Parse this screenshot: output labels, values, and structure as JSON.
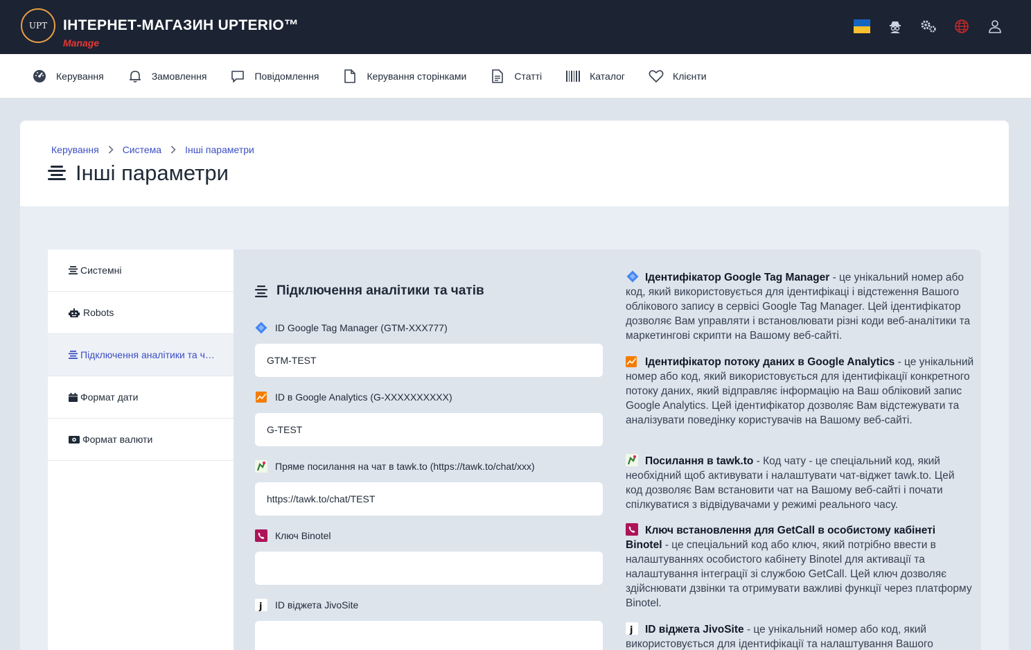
{
  "brand": {
    "logo_text": "UPT",
    "title": "ІНТЕРНЕТ-МАГАЗИН UPTERIO™",
    "subtitle": "Manage"
  },
  "top_icons": [
    "ukraine-flag-icon",
    "spy-icon",
    "gears-icon",
    "globe-icon",
    "user-icon"
  ],
  "nav": {
    "items": [
      {
        "label": "Керування",
        "icon": "dashboard-icon"
      },
      {
        "label": "Замовлення",
        "icon": "bell-icon"
      },
      {
        "label": "Повідомлення",
        "icon": "message-icon"
      },
      {
        "label": "Керування сторінками",
        "icon": "file-icon"
      },
      {
        "label": "Статті",
        "icon": "document-icon"
      },
      {
        "label": "Каталог",
        "icon": "barcode-icon"
      },
      {
        "label": "Клієнти",
        "icon": "heart-icon"
      }
    ]
  },
  "breadcrumb": [
    "Керування",
    "Система",
    "Інші параметри"
  ],
  "page_title": "Інші параметри",
  "sidebar": {
    "items": [
      {
        "label": "Системні",
        "icon": "list-icon",
        "active": false
      },
      {
        "label": "Robots",
        "icon": "robot-icon",
        "active": false
      },
      {
        "label": "Підключення аналітики та чатів",
        "icon": "list-icon",
        "active": true
      },
      {
        "label": "Формат дати",
        "icon": "calendar-icon",
        "active": false
      },
      {
        "label": "Формат валюти",
        "icon": "money-icon",
        "active": false
      }
    ]
  },
  "section_title": "Підключення аналітики та чатів",
  "fields": [
    {
      "label": "ID Google Tag Manager (GTM-XXX777)",
      "value": "GTM-TEST",
      "icon": "google-tag-manager-icon"
    },
    {
      "label": "ID в Google Analytics (G-XXXXXXXXXX)",
      "value": "G-TEST",
      "icon": "google-analytics-icon"
    },
    {
      "label": "Пряме посилання на чат в tawk.to (https://tawk.to/chat/xxx)",
      "value": "https://tawk.to/chat/TEST",
      "icon": "tawk-to-icon"
    },
    {
      "label": "Ключ Binotel",
      "value": "",
      "icon": "binotel-icon"
    },
    {
      "label": "ID віджета JivoSite",
      "value": "",
      "icon": "jivosite-icon"
    }
  ],
  "help": [
    {
      "title": "Ідентифікатор Google Tag Manager",
      "text": " - це унікальний номер або код, який використовується для ідентифікаці і відстеження Вашого облікового запису в сервісі Google Tag Manager. Цей ідентифікатор дозволяє Вам управляти і встановлювати різні коди веб-аналітики та маркетингові скрипти на Вашому веб-сайті."
    },
    {
      "title": "Ідентифікатор потоку даних в Google Analytics",
      "text": " - це унікальний номер або код, який використовується для ідентифікації конкретного потоку даних, який відправляє інформацію на Ваш обліковий запис Google Analytics. Цей ідентифікатор дозволяє Вам відстежувати та аналізувати поведінку користувачів на Вашому веб-сайті."
    },
    {
      "title": "Посилання в tawk.to",
      "text": " - Код чату - це спеціальний код, який необхідний щоб активувати і налаштувати чат-віджет tawk.to. Цей код дозволяє Вам встановити чат на Вашому веб-сайті і почати спілкуватися з відвідувачами у режимі реального часу."
    },
    {
      "title": "Ключ встановлення для GetCall в особистому кабінеті Binotel",
      "text": " - це спеціальний код або ключ, який потрібно ввести в налаштуваннях особистого кабінету Binotel для активації та налаштування інтеграції зі службою GetCall. Цей ключ дозволяє здійснювати дзвінки та отримувати важливі функції через платформу Binotel."
    },
    {
      "title": "ID віджета JivoSite",
      "text": " - це унікальний номер або код, який використовується для ідентифікації та налаштування Вашого"
    }
  ],
  "colors": {
    "topbar": "#1c2333",
    "accent": "#3b4fc4",
    "brand_sub": "#e53935",
    "logo_ring": "#e8a045"
  }
}
